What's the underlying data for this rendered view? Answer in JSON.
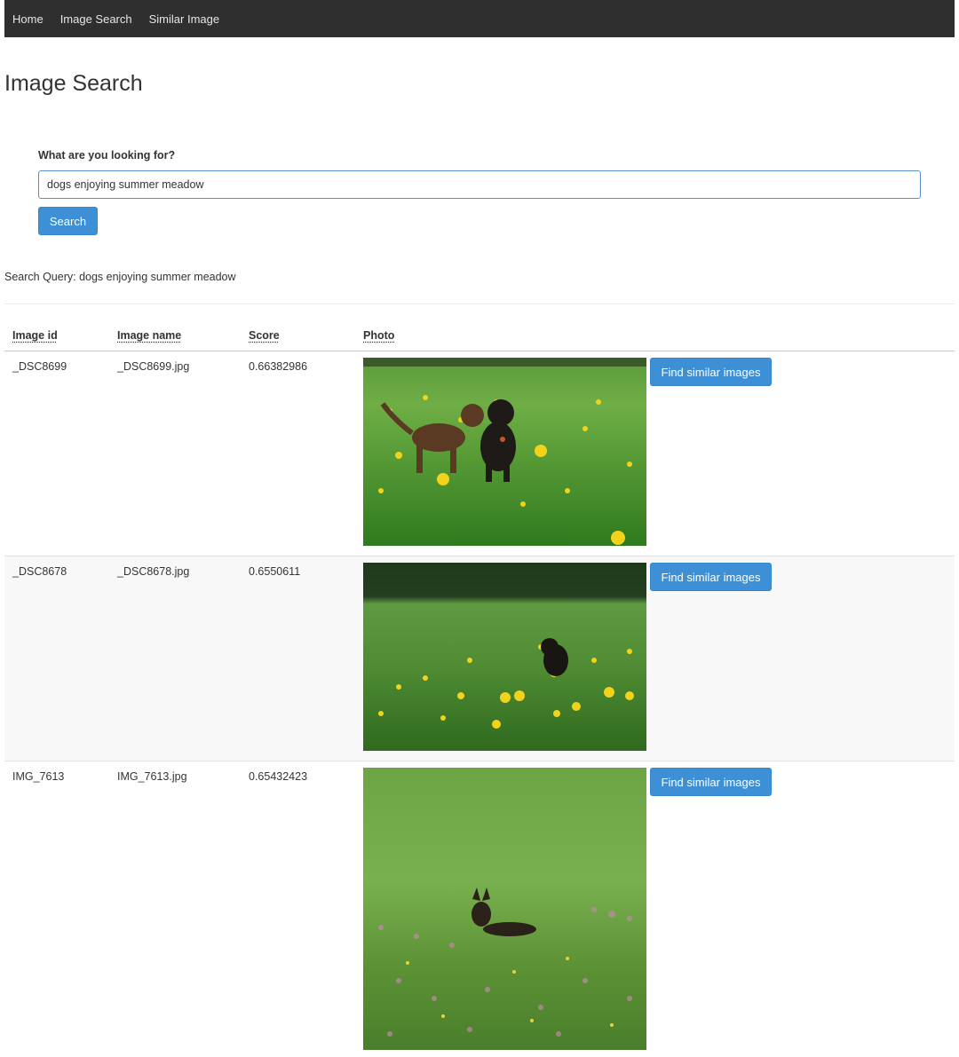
{
  "nav": {
    "items": [
      "Home",
      "Image Search",
      "Similar Image"
    ]
  },
  "page": {
    "title": "Image Search"
  },
  "search": {
    "label": "What are you looking for?",
    "value": "dogs enjoying summer meadow",
    "button": "Search"
  },
  "query_line": "Search Query: dogs enjoying summer meadow",
  "table": {
    "headers": [
      "Image id",
      "Image name",
      "Score",
      "Photo"
    ],
    "rows": [
      {
        "id": "_DSC8699",
        "name": "_DSC8699.jpg",
        "score": "0.66382986",
        "button": "Find similar images"
      },
      {
        "id": "_DSC8678",
        "name": "_DSC8678.jpg",
        "score": "0.6550611",
        "button": "Find similar images"
      },
      {
        "id": "IMG_7613",
        "name": "IMG_7613.jpg",
        "score": "0.65432423",
        "button": "Find similar images"
      }
    ]
  },
  "colors": {
    "navbar": "#2f2f2f",
    "primary_button": "#3d8fd6",
    "grass": "#4f9a2e",
    "flower_yellow": "#f2d21b"
  }
}
